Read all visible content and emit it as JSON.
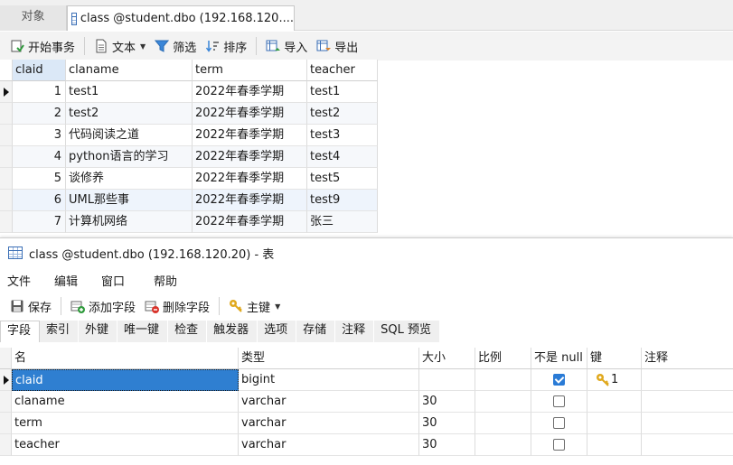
{
  "tabs": {
    "objects_label": "对象",
    "active_label": "class @student.dbo (192.168.120...."
  },
  "toolbar": {
    "begin_transaction": "开始事务",
    "text": "文本",
    "filter": "筛选",
    "sort": "排序",
    "import": "导入",
    "export": "导出"
  },
  "grid": {
    "columns": [
      "claid",
      "claname",
      "term",
      "teacher"
    ],
    "rows": [
      {
        "claid": "1",
        "claname": "test1",
        "term": "2022年春季学期",
        "teacher": "test1"
      },
      {
        "claid": "2",
        "claname": "test2",
        "term": "2022年春季学期",
        "teacher": "test2"
      },
      {
        "claid": "3",
        "claname": "代码阅读之道",
        "term": "2022年春季学期",
        "teacher": "test3"
      },
      {
        "claid": "4",
        "claname": "python语言的学习",
        "term": "2022年春季学期",
        "teacher": "test4"
      },
      {
        "claid": "5",
        "claname": "谈修养",
        "term": "2022年春季学期",
        "teacher": "test5"
      },
      {
        "claid": "6",
        "claname": "UML那些事",
        "term": "2022年春季学期",
        "teacher": "test9"
      },
      {
        "claid": "7",
        "claname": "计算机网络",
        "term": "2022年春季学期",
        "teacher": "张三"
      }
    ]
  },
  "designer": {
    "title": "class @student.dbo (192.168.120.20) - 表",
    "menu": [
      "文件",
      "编辑",
      "窗口",
      "帮助"
    ],
    "toolbar": {
      "save": "保存",
      "add_field": "添加字段",
      "delete_field": "删除字段",
      "primary_key": "主键"
    },
    "subtabs": [
      "字段",
      "索引",
      "外键",
      "唯一键",
      "检查",
      "触发器",
      "选项",
      "存储",
      "注释",
      "SQL 预览"
    ],
    "columns": [
      "名",
      "类型",
      "大小",
      "比例",
      "不是 null",
      "键",
      "注释"
    ],
    "fields": [
      {
        "name": "claid",
        "type": "bigint",
        "size": "",
        "scale": "",
        "not_null": true,
        "key": "1",
        "comment": ""
      },
      {
        "name": "claname",
        "type": "varchar",
        "size": "30",
        "scale": "",
        "not_null": false,
        "key": "",
        "comment": ""
      },
      {
        "name": "term",
        "type": "varchar",
        "size": "30",
        "scale": "",
        "not_null": false,
        "key": "",
        "comment": ""
      },
      {
        "name": "teacher",
        "type": "varchar",
        "size": "30",
        "scale": "",
        "not_null": false,
        "key": "",
        "comment": ""
      }
    ]
  },
  "colors": {
    "accent": "#2f7fd1",
    "selected_header": "#dbe8f7",
    "key_icon": "#e0a81c"
  }
}
